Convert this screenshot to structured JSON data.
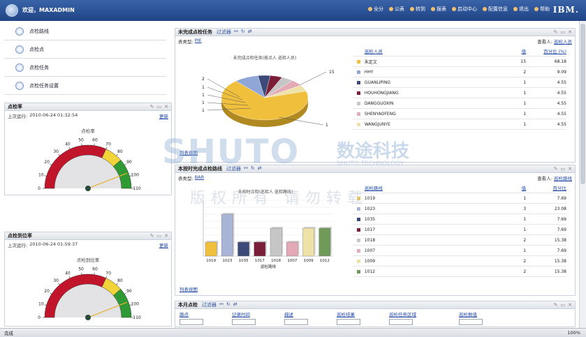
{
  "header": {
    "welcome": "欢迎，MAXADMIN",
    "nav": [
      "全分",
      "公表",
      "转到",
      "报表",
      "启动中心",
      "配置信息",
      "退出",
      "帮助"
    ],
    "brand": "IBM."
  },
  "leftnav": [
    "点检路线",
    "点检点",
    "点检任务",
    "点检任务设置"
  ],
  "gauge1": {
    "title": "点检率",
    "last_run_label": "上次运行:",
    "last_run": "2010-06-24 01:32:54",
    "refresh": "更新",
    "chart_title": "点检率",
    "ticks": [
      "0",
      "10",
      "20",
      "30",
      "40",
      "50",
      "60",
      "70",
      "80",
      "90",
      "100",
      "110"
    ]
  },
  "gauge2": {
    "title": "点检到位率",
    "last_run_label": "上次运行:",
    "last_run": "2010-06-24 01:59:37",
    "refresh": "更新",
    "chart_title": "点检到位率",
    "ticks": [
      "0",
      "10",
      "20",
      "30",
      "40",
      "50",
      "60",
      "70",
      "80",
      "90",
      "100",
      "110"
    ]
  },
  "panel_pie": {
    "title": "未完成点检任务",
    "filter": "过滤器",
    "type_label": "表类型:",
    "type_value": "PIE",
    "viewby_label": "查看人:",
    "viewby_value": "巡检人员",
    "col_name": "巡检人员",
    "col_val": "值",
    "col_pct": "百分比 (%)",
    "list_view": "列表视图",
    "chart_title": "未完成点检任务(按点人 巡检人员)",
    "pie_labels": [
      "15",
      "2",
      "1",
      "1",
      "1",
      "1",
      "1"
    ]
  },
  "panel_bar": {
    "title": "本按时完成点检路线",
    "filter": "过滤器",
    "type_label": "表类型:",
    "type_value": "BAR",
    "viewby_label": "查看人:",
    "viewby_value": "巡检路线",
    "col_name": "巡检路线",
    "col_val": "值",
    "col_pct": "百分比",
    "list_view": "列表视图",
    "chart_title": "未按时点检(巡检人 巡检路线)",
    "xlabel": "巡检路线"
  },
  "panel_month": {
    "title": "本月点检",
    "filter": "过滤器",
    "cols": [
      "路点",
      "记录时间",
      "描述",
      "巡检结果",
      "巡检任务区域",
      "巡检数值"
    ]
  },
  "watermark": {
    "brand": "SHUTO",
    "cn": "数途科技",
    "en": "SHUTO TECHNOLOGY",
    "copy": "版权所有 请勿转载"
  },
  "status": {
    "text": "完成",
    "zoom": "100%"
  },
  "pie_rows": [
    {
      "name": "朱定文",
      "value": "15",
      "pct": "68.18",
      "color": "#f0c03c"
    },
    {
      "name": "HHY",
      "value": "2",
      "pct": "9.09",
      "color": "#8fa6d6"
    },
    {
      "name": "GUANLIPING",
      "value": "1",
      "pct": "4.55",
      "color": "#3c4a7a"
    },
    {
      "name": "HOUHONGJIANG",
      "value": "1",
      "pct": "4.55",
      "color": "#7a1e3a"
    },
    {
      "name": "DANGGUOXIN",
      "value": "1",
      "pct": "4.55",
      "color": "#c6c6c6"
    },
    {
      "name": "SHENYAOFENG",
      "value": "1",
      "pct": "4.55",
      "color": "#e3a9b5"
    },
    {
      "name": "WANGJUNYE",
      "value": "1",
      "pct": "4.55",
      "color": "#efe2a8"
    }
  ],
  "chart_data": [
    {
      "type": "pie",
      "title": "未完成点检任务(按点人 巡检人员)",
      "categories": [
        "朱定文",
        "HHY",
        "GUANLIPING",
        "HOUHONGJIANG",
        "DANGGUOXIN",
        "SHENYAOFENG",
        "WANGJUNYE"
      ],
      "values": [
        15,
        2,
        1,
        1,
        1,
        1,
        1
      ]
    },
    {
      "type": "bar",
      "title": "未按时点检(巡检人 巡检路线)",
      "categories": [
        "1019",
        "1023",
        "1035",
        "1017",
        "1018",
        "1007",
        "1009",
        "1012"
      ],
      "values": [
        1,
        3,
        1,
        1,
        2,
        1,
        2,
        2
      ],
      "percent": [
        "7.69",
        "23.08",
        "7.69",
        "7.69",
        "15.38",
        "7.69",
        "15.38",
        "15.38"
      ],
      "colors": [
        "#f0c03c",
        "#a8b4d8",
        "#3c4a7a",
        "#7a1e3a",
        "#c6c6c6",
        "#e3a9b5",
        "#efe2a8",
        "#6f9a5a"
      ],
      "xlabel": "巡检路线",
      "ylim": [
        0,
        4
      ]
    }
  ]
}
